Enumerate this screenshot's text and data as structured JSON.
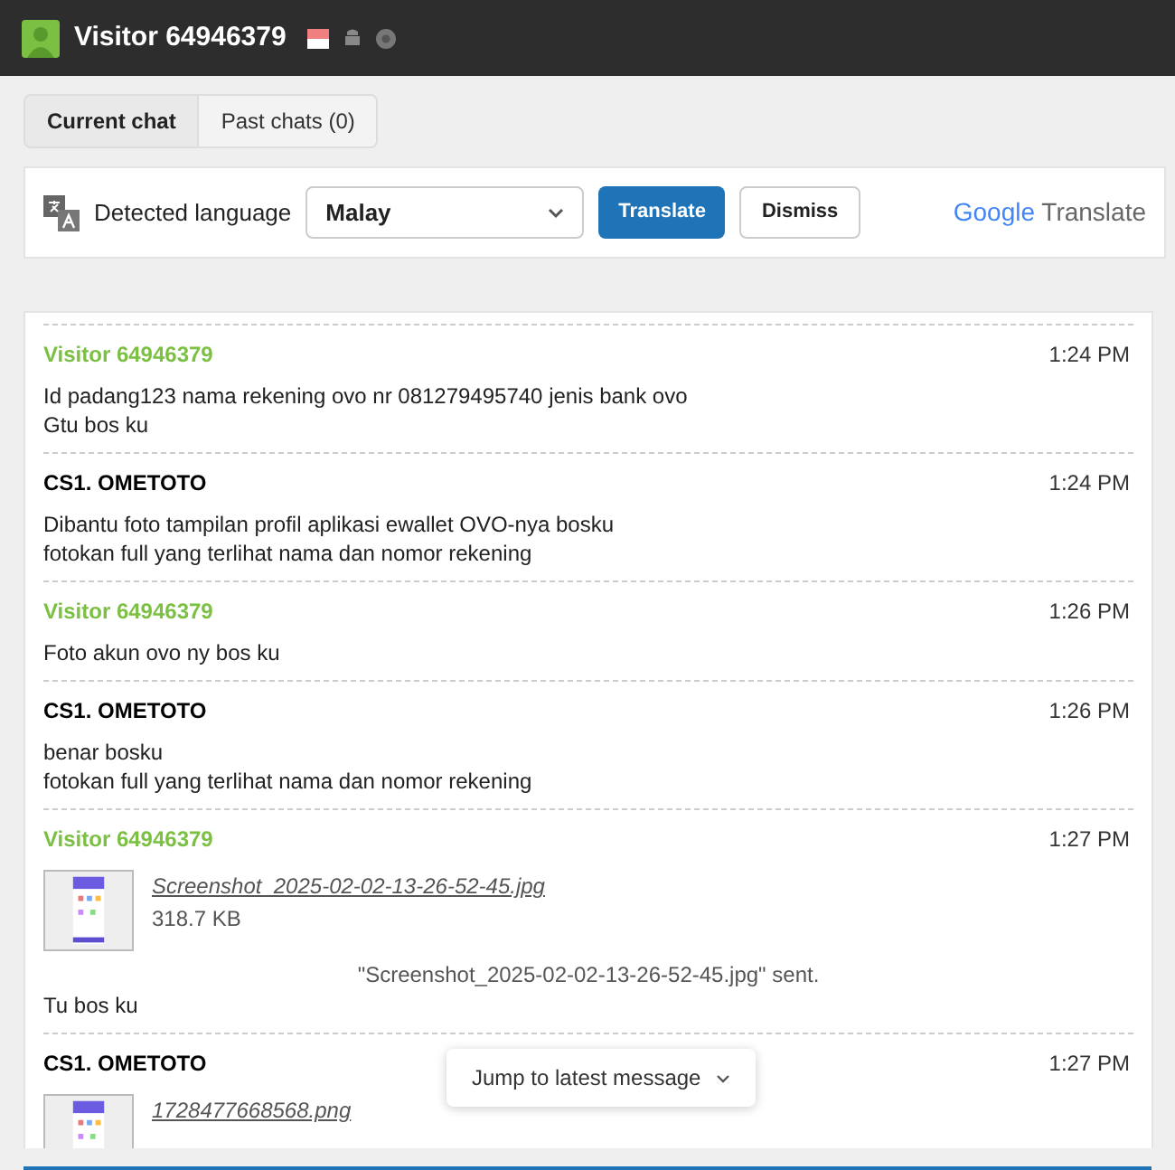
{
  "header": {
    "title": "Visitor 64946379"
  },
  "tabs": [
    {
      "label": "Current chat",
      "selected": true
    },
    {
      "label": "Past chats (0)",
      "selected": false
    }
  ],
  "translate_bar": {
    "label": "Detected language",
    "language": "Malay",
    "translate_button": "Translate",
    "dismiss_button": "Dismiss",
    "brand": "Google",
    "brand_suffix": "Translate"
  },
  "messages": [
    {
      "kind": "visitor",
      "sender": "Visitor 64946379",
      "time": "1:24 PM",
      "lines": [
        "Id padang123 nama rekening ovo nr 081279495740 jenis bank ovo",
        "Gtu bos ku"
      ]
    },
    {
      "kind": "agent",
      "sender": "CS1. OMETOTO",
      "time": "1:24 PM",
      "lines": [
        "Dibantu foto tampilan profil aplikasi ewallet OVO-nya bosku",
        "fotokan full yang terlihat nama dan nomor rekening"
      ]
    },
    {
      "kind": "visitor",
      "sender": "Visitor 64946379",
      "time": "1:26 PM",
      "lines": [
        "Foto akun ovo ny bos ku"
      ]
    },
    {
      "kind": "agent",
      "sender": "CS1. OMETOTO",
      "time": "1:26 PM",
      "lines": [
        "benar bosku",
        "fotokan full yang terlihat nama dan nomor rekening"
      ]
    },
    {
      "kind": "visitor",
      "sender": "Visitor 64946379",
      "time": "1:27 PM",
      "file": {
        "name": "Screenshot_2025-02-02-13-26-52-45.jpg",
        "size": "318.7 KB",
        "notice": "\"Screenshot_2025-02-02-13-26-52-45.jpg\" sent."
      },
      "lines": [
        "Tu bos ku"
      ]
    },
    {
      "kind": "agent",
      "sender": "CS1. OMETOTO",
      "time": "1:27 PM",
      "file": {
        "name": "1728477668568.png"
      }
    }
  ],
  "jump_button": "Jump to latest message"
}
